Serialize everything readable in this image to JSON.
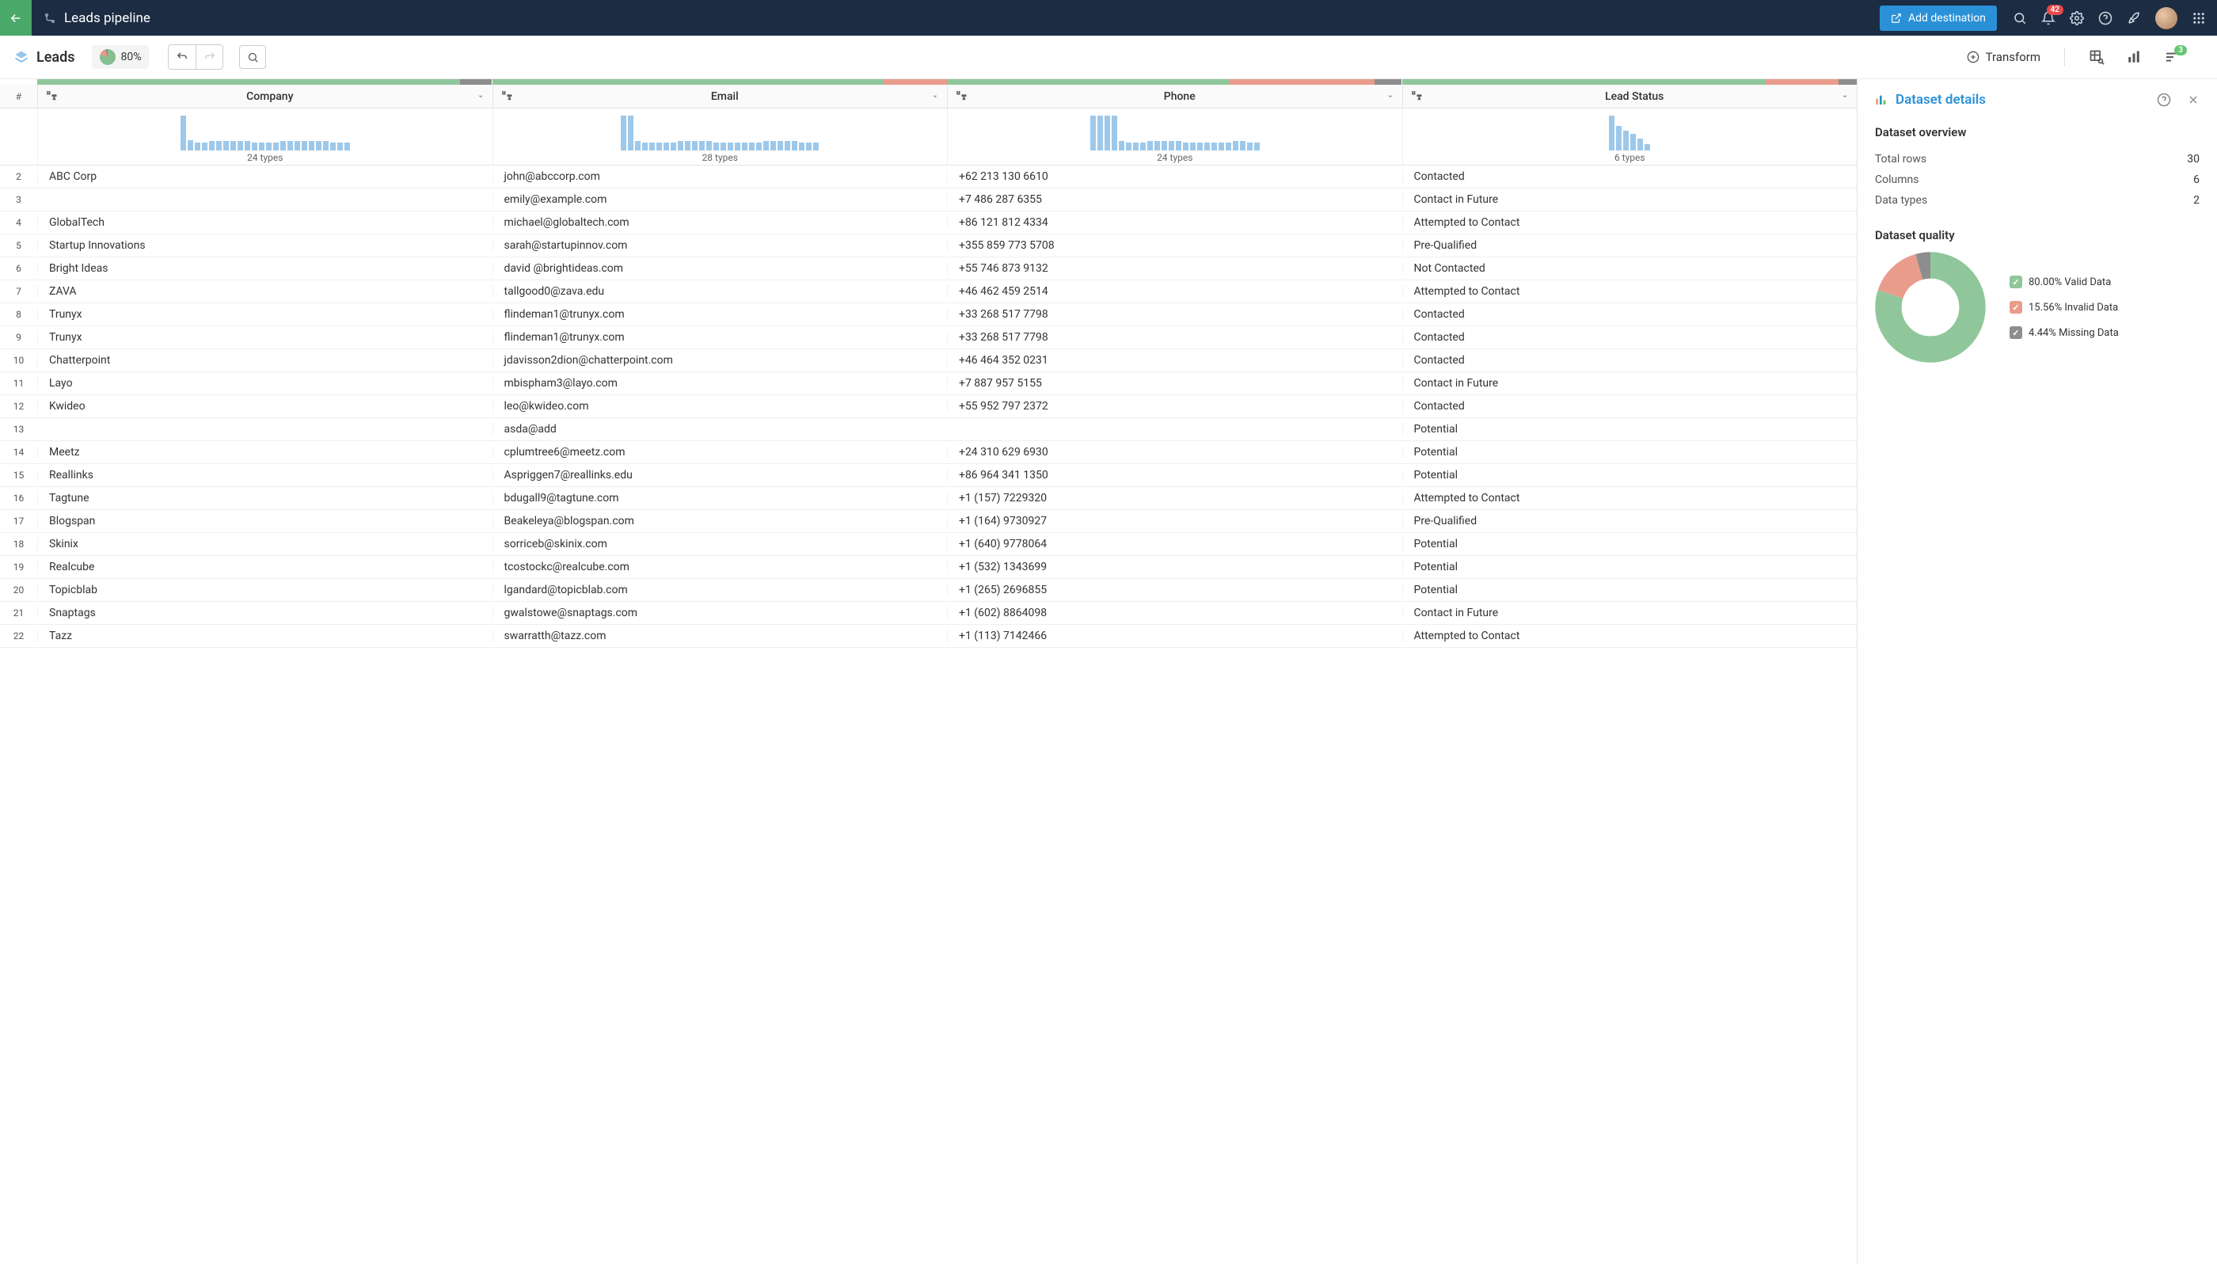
{
  "header": {
    "title": "Leads pipeline",
    "add_destination": "Add destination",
    "notif_count": "42"
  },
  "toolbar": {
    "dataset_name": "Leads",
    "quality_pct": "80%",
    "transform_label": "Transform",
    "badge_count": "3"
  },
  "columns": [
    {
      "name": "Company",
      "types_label": "24 types",
      "quality": {
        "valid": 93,
        "invalid": 0,
        "missing": 7
      },
      "hist": [
        42,
        12,
        10,
        10,
        11,
        11,
        11,
        11,
        11,
        11,
        10,
        10,
        10,
        10,
        11,
        11,
        11,
        11,
        11,
        11,
        11,
        10,
        10,
        10
      ]
    },
    {
      "name": "Email",
      "types_label": "28 types",
      "quality": {
        "valid": 86,
        "invalid": 14,
        "missing": 0
      },
      "hist": [
        42,
        42,
        11,
        10,
        10,
        10,
        10,
        10,
        11,
        11,
        11,
        11,
        11,
        10,
        10,
        10,
        10,
        10,
        10,
        10,
        11,
        11,
        11,
        11,
        11,
        10,
        10,
        10
      ]
    },
    {
      "name": "Phone",
      "types_label": "24 types",
      "quality": {
        "valid": 62,
        "invalid": 32,
        "missing": 6
      },
      "hist": [
        42,
        42,
        42,
        42,
        11,
        10,
        10,
        10,
        11,
        11,
        11,
        11,
        11,
        10,
        10,
        10,
        10,
        10,
        10,
        10,
        11,
        11,
        10,
        10
      ]
    },
    {
      "name": "Lead Status",
      "types_label": "6 types",
      "quality": {
        "valid": 80,
        "invalid": 16,
        "missing": 4
      },
      "hist": [
        42,
        30,
        24,
        20,
        14,
        8
      ]
    }
  ],
  "rows": [
    {
      "n": 2,
      "company": "ABC Corp",
      "email": "john@abccorp.com",
      "phone": "+62 213 130 6610",
      "status": "Contacted"
    },
    {
      "n": 3,
      "company": "",
      "email": "emily@example.com",
      "phone": "+7 486 287 6355",
      "status": "Contact in Future"
    },
    {
      "n": 4,
      "company": "GlobalTech",
      "email": "michael@globaltech.com",
      "phone": "+86 121 812 4334",
      "status": "Attempted to Contact"
    },
    {
      "n": 5,
      "company": "Startup Innovations",
      "email": "sarah@startupinnov.com",
      "phone": "+355 859 773 5708",
      "status": "Pre-Qualified"
    },
    {
      "n": 6,
      "company": "Bright Ideas",
      "email": "david  @brightideas.com",
      "phone": "+55 746 873 9132",
      "status": "Not Contacted"
    },
    {
      "n": 7,
      "company": "ZAVA",
      "email": "tallgood0@zava.edu",
      "phone": "+46 462 459 2514",
      "status": "Attempted to Contact"
    },
    {
      "n": 8,
      "company": "Trunyx",
      "email": "flindeman1@trunyx.com",
      "phone": "+33 268 517 7798",
      "status": "Contacted"
    },
    {
      "n": 9,
      "company": "Trunyx",
      "email": "flindeman1@trunyx.com",
      "phone": "+33 268 517 7798",
      "status": "Contacted"
    },
    {
      "n": 10,
      "company": "Chatterpoint",
      "email": "jdavisson2dion@chatterpoint.com",
      "phone": "+46 464 352 0231",
      "status": "Contacted"
    },
    {
      "n": 11,
      "company": "Layo",
      "email": "mbispham3@layo.com",
      "phone": "+7 887 957 5155",
      "status": "Contact in Future"
    },
    {
      "n": 12,
      "company": "Kwideo",
      "email": "leo@kwideo.com",
      "phone": "+55 952 797 2372",
      "status": "Contacted"
    },
    {
      "n": 13,
      "company": "",
      "email": "asda@add",
      "phone": "",
      "status": "Potential"
    },
    {
      "n": 14,
      "company": "Meetz",
      "email": "cplumtree6@meetz.com",
      "phone": "+24 310 629 6930",
      "status": "Potential"
    },
    {
      "n": 15,
      "company": "Reallinks",
      "email": "Aspriggen7@reallinks.edu",
      "phone": "+86 964 341 1350",
      "status": "Potential"
    },
    {
      "n": 16,
      "company": "Tagtune",
      "email": "bdugall9@tagtune.com",
      "phone": "+1 (157) 7229320",
      "status": "Attempted to Contact"
    },
    {
      "n": 17,
      "company": "Blogspan",
      "email": "Beakeleya@blogspan.com",
      "phone": "+1 (164) 9730927",
      "status": "Pre-Qualified"
    },
    {
      "n": 18,
      "company": "Skinix",
      "email": "sorriceb@skinix.com",
      "phone": "+1 (640) 9778064",
      "status": "Potential"
    },
    {
      "n": 19,
      "company": "Realcube",
      "email": "tcostockc@realcube.com",
      "phone": "+1 (532) 1343699",
      "status": "Potential"
    },
    {
      "n": 20,
      "company": "Topicblab",
      "email": "lgandard@topicblab.com",
      "phone": "+1 (265) 2696855",
      "status": "Potential"
    },
    {
      "n": 21,
      "company": "Snaptags",
      "email": "gwalstowe@snaptags.com",
      "phone": "+1 (602) 8864098",
      "status": "Contact in Future"
    },
    {
      "n": 22,
      "company": "Tazz",
      "email": "swarratth@tazz.com",
      "phone": "+1 (113) 7142466",
      "status": "Attempted to Contact"
    }
  ],
  "sidepanel": {
    "title": "Dataset details",
    "overview_title": "Dataset overview",
    "overview": [
      {
        "k": "Total rows",
        "v": "30"
      },
      {
        "k": "Columns",
        "v": "6"
      },
      {
        "k": "Data types",
        "v": "2"
      }
    ],
    "quality_title": "Dataset quality",
    "quality_legend": [
      {
        "label": "80.00% Valid Data",
        "color": "#8fc79b",
        "pct": 80.0
      },
      {
        "label": "15.56% Invalid Data",
        "color": "#e99c8c",
        "pct": 15.56
      },
      {
        "label": "4.44% Missing Data",
        "color": "#8d8d8d",
        "pct": 4.44
      }
    ]
  },
  "chart_data": {
    "type": "pie",
    "title": "Dataset quality",
    "series": [
      {
        "name": "Valid Data",
        "value": 80.0
      },
      {
        "name": "Invalid Data",
        "value": 15.56
      },
      {
        "name": "Missing Data",
        "value": 4.44
      }
    ]
  }
}
